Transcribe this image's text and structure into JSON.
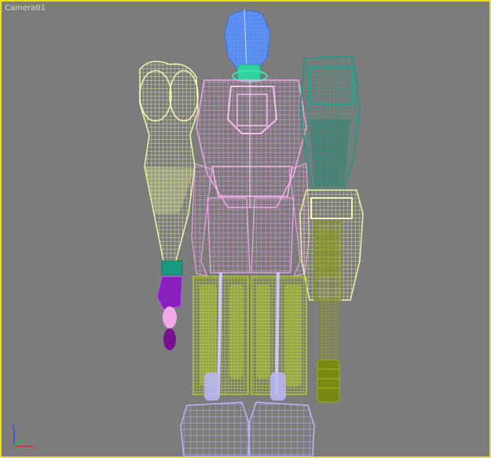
{
  "viewport": {
    "label": "Camera01",
    "border_color": "#e8e01a",
    "background": "#7c7c7c"
  },
  "model": {
    "parts": [
      {
        "name": "head",
        "color": "#5a8cf0"
      },
      {
        "name": "neck",
        "color": "#30d0a0"
      },
      {
        "name": "torso",
        "color": "#f0a8e8"
      },
      {
        "name": "left-arm",
        "color": "#e8f0a0"
      },
      {
        "name": "right-arm-upper",
        "color": "#1a9a80"
      },
      {
        "name": "right-arm-lower",
        "color": "#f0f0a8"
      },
      {
        "name": "right-cannon",
        "color": "#8a9a10"
      },
      {
        "name": "left-hand",
        "color": "#8a20c0"
      },
      {
        "name": "legs",
        "color": "#b0c830"
      },
      {
        "name": "feet",
        "color": "#b8b8f8"
      }
    ]
  },
  "gizmo": {
    "x_color": "#e03030",
    "y_color": "#30c030",
    "z_color": "#3050e0"
  }
}
